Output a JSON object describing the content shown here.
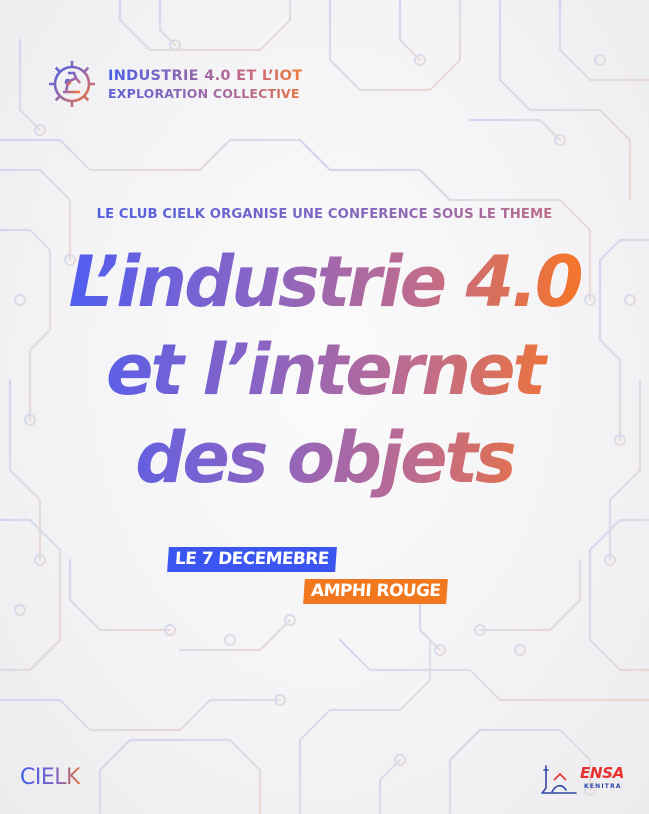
{
  "brand": {
    "line1": "INDUSTRIE 4.0 ET L’IOT",
    "line2": "EXPLORATION COLLECTIVE"
  },
  "intro": "LE CLUB CIELK ORGANISE UNE CONFÉRENCE SOUS LE THÈME",
  "title": {
    "line1": "L’industrie 4.0",
    "line2": "et l’internet",
    "line3": "des objets"
  },
  "date_tag": "LE 7 DECEMEBRE",
  "place_tag": "AMPHI ROUGE",
  "footer": {
    "club_logo": "CIELK",
    "school_logo": "ENSA",
    "school_city": "KENITRA"
  },
  "colors": {
    "accent_blue": "#3b55f0",
    "accent_orange": "#f2781f",
    "gradient_start": "#4f5ef0",
    "gradient_end": "#f3742e",
    "ensa_red": "#e8302e",
    "circuit_line": "#d9d7e6"
  },
  "icons": {
    "brand": "gear-with-robot-arm-icon",
    "school": "ensa-emblem-icon"
  }
}
